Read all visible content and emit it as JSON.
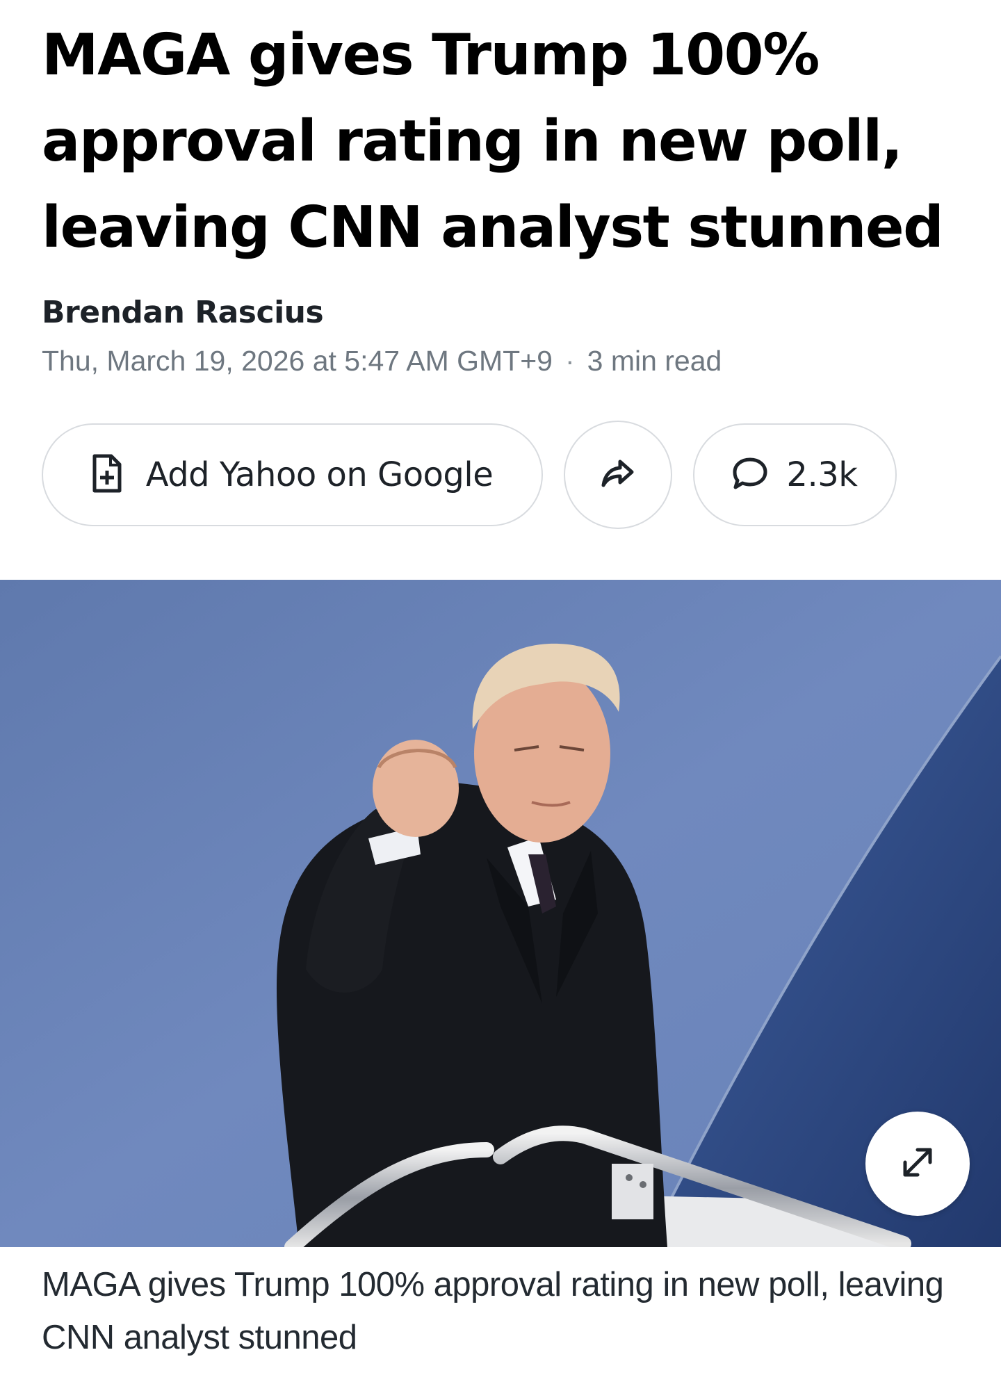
{
  "article": {
    "headline": "MAGA gives Trump 100% approval rating in new poll, leaving CNN analyst stunned",
    "author": "Brendan Rascius",
    "timestamp": "Thu, March 19, 2026 at 5:47 AM GMT+9",
    "separator": "·",
    "read_time": "3 min read"
  },
  "actions": {
    "google_label": "Add Yahoo on Google",
    "google_icon": "add-document-icon",
    "share_icon": "share-arrow-icon",
    "comment_icon": "comment-bubble-icon",
    "comment_count": "2.3k"
  },
  "image": {
    "description_icon": "expand-icon",
    "caption": "MAGA gives Trump 100% approval rating in new poll, leaving CNN analyst stunned"
  },
  "colors": {
    "sky": "#6b84b8",
    "plane_blue": "#2f4d8a",
    "coat": "#16181d",
    "text_dark": "#000000",
    "text_muted": "#6e7780",
    "button_border": "#d8dbdf"
  }
}
